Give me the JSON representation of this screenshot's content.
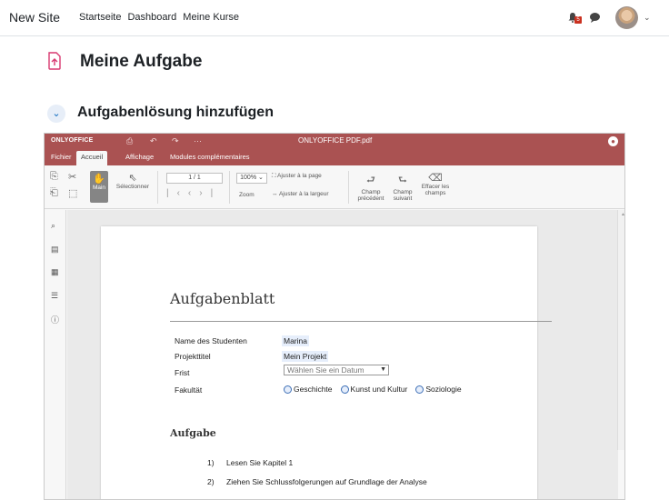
{
  "topnav": {
    "site_name": "New Site",
    "links": [
      "Startseite",
      "Dashboard",
      "Meine Kurse"
    ],
    "notification_count": "5"
  },
  "page": {
    "title": "Meine Aufgabe",
    "section_title": "Aufgabenlösung hinzufügen"
  },
  "editor": {
    "logo": "ONLYOFFICE",
    "doc_title": "ONLYOFFICE PDF.pdf",
    "tabs": [
      "Fichier",
      "Accueil",
      "Affichage",
      "Modules complémentaires"
    ],
    "active_tab": "Accueil",
    "toolbar": {
      "main_label": "Main",
      "select_label": "Sélectionner",
      "page_value": "1 / 1",
      "zoom_value": "100%",
      "zoom_label": "Zoom",
      "fit_page": "Ajuster à la page",
      "fit_width": "Ajuster à la largeur",
      "prev_field_1": "Champ",
      "prev_field_2": "précédent",
      "next_field_1": "Champ",
      "next_field_2": "suivant",
      "clear_1": "Effacer les",
      "clear_2": "champs"
    }
  },
  "document": {
    "heading": "Aufgabenblatt",
    "labels": {
      "student": "Name des Studenten",
      "project": "Projekttitel",
      "deadline": "Frist",
      "faculty": "Fakultät"
    },
    "values": {
      "student": "Marina",
      "project": "Mein Projekt",
      "deadline_placeholder": "Wählen Sie ein Datum"
    },
    "faculty_options": [
      "Geschichte",
      "Kunst und Kultur",
      "Soziologie"
    ],
    "section_heading": "Aufgabe",
    "tasks": [
      {
        "num": "1)",
        "text": "Lesen Sie Kapitel 1"
      },
      {
        "num": "2)",
        "text": "Ziehen Sie Schlussfolgerungen auf Grundlage der Analyse"
      }
    ]
  },
  "colors": {
    "editor_brand": "#aa5252",
    "link_accent": "#0f6cbf",
    "badge": "#ca3120"
  }
}
